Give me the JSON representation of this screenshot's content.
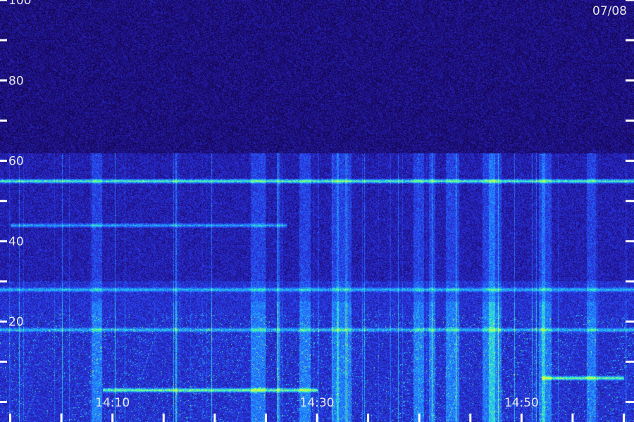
{
  "chart_data": {
    "type": "heatmap",
    "title": "",
    "xlabel": "",
    "ylabel": "",
    "date_label": "07/08",
    "y_ticks": [
      {
        "value": 0,
        "label": ""
      },
      {
        "value": 10,
        "label": ""
      },
      {
        "value": 20,
        "label": "20"
      },
      {
        "value": 30,
        "label": ""
      },
      {
        "value": 40,
        "label": "40"
      },
      {
        "value": 50,
        "label": ""
      },
      {
        "value": 60,
        "label": "60"
      },
      {
        "value": 70,
        "label": ""
      },
      {
        "value": 80,
        "label": "80"
      },
      {
        "value": 90,
        "label": ""
      },
      {
        "value": 100,
        "label": "100"
      }
    ],
    "ylim": [
      -5,
      100
    ],
    "x_ticks": [
      {
        "time": "14:10",
        "label": "14:10"
      },
      {
        "time": "14:30",
        "label": "14:30"
      },
      {
        "time": "14:50",
        "label": "14:50"
      }
    ],
    "x_minor_ticks": [
      "14:00",
      "14:05",
      "14:10",
      "14:15",
      "14:20",
      "14:25",
      "14:30",
      "14:35",
      "14:40",
      "14:45",
      "14:50",
      "14:55",
      "15:00"
    ],
    "xlim": [
      "13:59",
      "15:01"
    ],
    "bands": [
      {
        "y": 55,
        "intensity": "strong"
      },
      {
        "y": 44,
        "intensity": "moderate",
        "start": "14:00",
        "end": "14:27"
      },
      {
        "y": 28,
        "intensity": "moderate"
      },
      {
        "y": 18,
        "intensity": "moderate"
      },
      {
        "y": 3,
        "intensity": "strong",
        "start": "14:09",
        "end": "14:30"
      },
      {
        "y": 6,
        "intensity": "strong",
        "start": "14:52",
        "end": "15:00"
      }
    ],
    "colormap": [
      "#000000",
      "#1e0a78",
      "#2a3cf0",
      "#1ea8ff",
      "#40ffb0",
      "#f0ff30"
    ],
    "background": "#000000",
    "grid": false
  }
}
